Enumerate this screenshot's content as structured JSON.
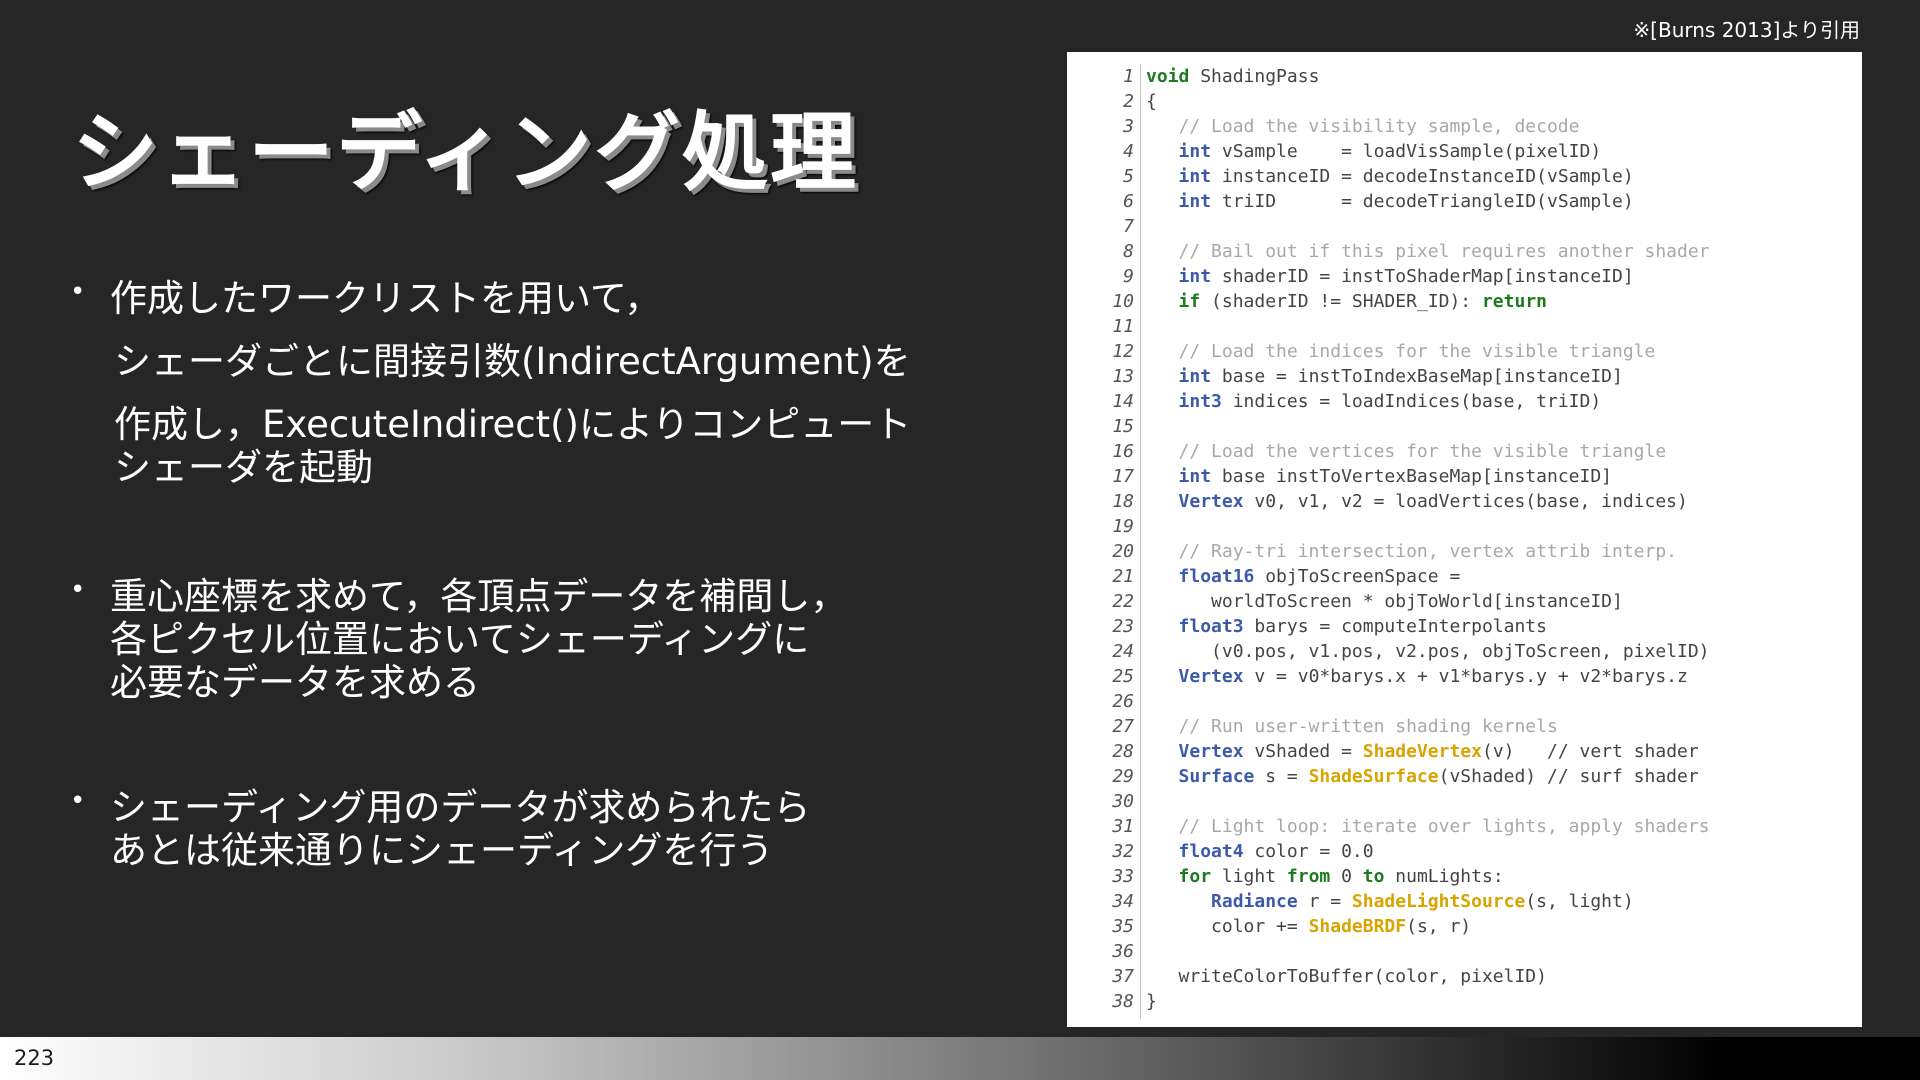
{
  "slide": {
    "citation": "※[Burns 2013]より引用",
    "title": "シェーディング処理",
    "page_number": "223"
  },
  "bullets": [
    {
      "lines": [
        "作成したワークリストを用いて，",
        "シェーダごとに間接引数(IndirectArgument)を",
        "作成し，ExecuteIndirect()によりコンピュート",
        "シェーダを起動"
      ]
    },
    {
      "lines": [
        "重心座標を求めて，各頂点データを補間し，",
        "各ピクセル位置においてシェーディングに",
        "必要なデータを求める"
      ]
    },
    {
      "lines": [
        "シェーディング用のデータが求められたら",
        "あとは従来通りにシェーディングを行う"
      ]
    }
  ],
  "code": {
    "colors": {
      "keyword": "#1f7a1f",
      "type": "#3d5aa8",
      "comment": "#a8a8a8",
      "function": "#d9a400",
      "plain": "#444444"
    },
    "lines": [
      {
        "n": "1",
        "tokens": [
          [
            "kw",
            "void"
          ],
          [
            "p",
            " ShadingPass"
          ]
        ]
      },
      {
        "n": "2",
        "tokens": [
          [
            "p",
            "{"
          ]
        ]
      },
      {
        "n": "3",
        "tokens": [
          [
            "p",
            "   "
          ],
          [
            "c",
            "// Load the visibility sample, decode"
          ]
        ]
      },
      {
        "n": "4",
        "tokens": [
          [
            "p",
            "   "
          ],
          [
            "t",
            "int"
          ],
          [
            "p",
            " vSample    = loadVisSample(pixelID)"
          ]
        ]
      },
      {
        "n": "5",
        "tokens": [
          [
            "p",
            "   "
          ],
          [
            "t",
            "int"
          ],
          [
            "p",
            " instanceID = decodeInstanceID(vSample)"
          ]
        ]
      },
      {
        "n": "6",
        "tokens": [
          [
            "p",
            "   "
          ],
          [
            "t",
            "int"
          ],
          [
            "p",
            " triID      = decodeTriangleID(vSample)"
          ]
        ]
      },
      {
        "n": "7",
        "tokens": []
      },
      {
        "n": "8",
        "tokens": [
          [
            "p",
            "   "
          ],
          [
            "c",
            "// Bail out if this pixel requires another shader"
          ]
        ]
      },
      {
        "n": "9",
        "tokens": [
          [
            "p",
            "   "
          ],
          [
            "t",
            "int"
          ],
          [
            "p",
            " shaderID = instToShaderMap[instanceID]"
          ]
        ]
      },
      {
        "n": "10",
        "tokens": [
          [
            "p",
            "   "
          ],
          [
            "kw",
            "if"
          ],
          [
            "p",
            " (shaderID != SHADER_ID): "
          ],
          [
            "kw",
            "return"
          ]
        ]
      },
      {
        "n": "11",
        "tokens": []
      },
      {
        "n": "12",
        "tokens": [
          [
            "p",
            "   "
          ],
          [
            "c",
            "// Load the indices for the visible triangle"
          ]
        ]
      },
      {
        "n": "13",
        "tokens": [
          [
            "p",
            "   "
          ],
          [
            "t",
            "int"
          ],
          [
            "p",
            " base = instToIndexBaseMap[instanceID]"
          ]
        ]
      },
      {
        "n": "14",
        "tokens": [
          [
            "p",
            "   "
          ],
          [
            "t",
            "int3"
          ],
          [
            "p",
            " indices = loadIndices(base, triID)"
          ]
        ]
      },
      {
        "n": "15",
        "tokens": []
      },
      {
        "n": "16",
        "tokens": [
          [
            "p",
            "   "
          ],
          [
            "c",
            "// Load the vertices for the visible triangle"
          ]
        ]
      },
      {
        "n": "17",
        "tokens": [
          [
            "p",
            "   "
          ],
          [
            "t",
            "int"
          ],
          [
            "p",
            " base instToVertexBaseMap[instanceID]"
          ]
        ]
      },
      {
        "n": "18",
        "tokens": [
          [
            "p",
            "   "
          ],
          [
            "t",
            "Vertex"
          ],
          [
            "p",
            " v0, v1, v2 = loadVertices(base, indices)"
          ]
        ]
      },
      {
        "n": "19",
        "tokens": []
      },
      {
        "n": "20",
        "tokens": [
          [
            "p",
            "   "
          ],
          [
            "c",
            "// Ray-tri intersection, vertex attrib interp."
          ]
        ]
      },
      {
        "n": "21",
        "tokens": [
          [
            "p",
            "   "
          ],
          [
            "t",
            "float16"
          ],
          [
            "p",
            " objToScreenSpace ="
          ]
        ]
      },
      {
        "n": "22",
        "tokens": [
          [
            "p",
            "      worldToScreen * objToWorld[instanceID]"
          ]
        ]
      },
      {
        "n": "23",
        "tokens": [
          [
            "p",
            "   "
          ],
          [
            "t",
            "float3"
          ],
          [
            "p",
            " barys = computeInterpolants"
          ]
        ]
      },
      {
        "n": "24",
        "tokens": [
          [
            "p",
            "      (v0.pos, v1.pos, v2.pos, objToScreen, pixelID)"
          ]
        ]
      },
      {
        "n": "25",
        "tokens": [
          [
            "p",
            "   "
          ],
          [
            "t",
            "Vertex"
          ],
          [
            "p",
            " v = v0*barys.x + v1*barys.y + v2*barys.z"
          ]
        ]
      },
      {
        "n": "26",
        "tokens": []
      },
      {
        "n": "27",
        "tokens": [
          [
            "p",
            "   "
          ],
          [
            "c",
            "// Run user-written shading kernels"
          ]
        ]
      },
      {
        "n": "28",
        "tokens": [
          [
            "p",
            "   "
          ],
          [
            "t",
            "Vertex"
          ],
          [
            "p",
            " vShaded = "
          ],
          [
            "f",
            "ShadeVertex"
          ],
          [
            "p",
            "(v)   "
          ],
          [
            "p",
            "// vert shader"
          ]
        ]
      },
      {
        "n": "29",
        "tokens": [
          [
            "p",
            "   "
          ],
          [
            "t",
            "Surface"
          ],
          [
            "p",
            " s = "
          ],
          [
            "f",
            "ShadeSurface"
          ],
          [
            "p",
            "(vShaded) // surf shader"
          ]
        ]
      },
      {
        "n": "30",
        "tokens": []
      },
      {
        "n": "31",
        "tokens": [
          [
            "p",
            "   "
          ],
          [
            "c",
            "// Light loop: iterate over lights, apply shaders"
          ]
        ]
      },
      {
        "n": "32",
        "tokens": [
          [
            "p",
            "   "
          ],
          [
            "t",
            "float4"
          ],
          [
            "p",
            " color = 0.0"
          ]
        ]
      },
      {
        "n": "33",
        "tokens": [
          [
            "p",
            "   "
          ],
          [
            "kw",
            "for"
          ],
          [
            "p",
            " light "
          ],
          [
            "kw",
            "from"
          ],
          [
            "p",
            " 0 "
          ],
          [
            "kw",
            "to"
          ],
          [
            "p",
            " numLights:"
          ]
        ]
      },
      {
        "n": "34",
        "tokens": [
          [
            "p",
            "      "
          ],
          [
            "t",
            "Radiance"
          ],
          [
            "p",
            " r = "
          ],
          [
            "f",
            "ShadeLightSource"
          ],
          [
            "p",
            "(s, light)"
          ]
        ]
      },
      {
        "n": "35",
        "tokens": [
          [
            "p",
            "      color += "
          ],
          [
            "f",
            "ShadeBRDF"
          ],
          [
            "p",
            "(s, r)"
          ]
        ]
      },
      {
        "n": "36",
        "tokens": []
      },
      {
        "n": "37",
        "tokens": [
          [
            "p",
            "   writeColorToBuffer(color, pixelID)"
          ]
        ]
      },
      {
        "n": "38",
        "tokens": [
          [
            "p",
            "}"
          ]
        ]
      }
    ]
  }
}
